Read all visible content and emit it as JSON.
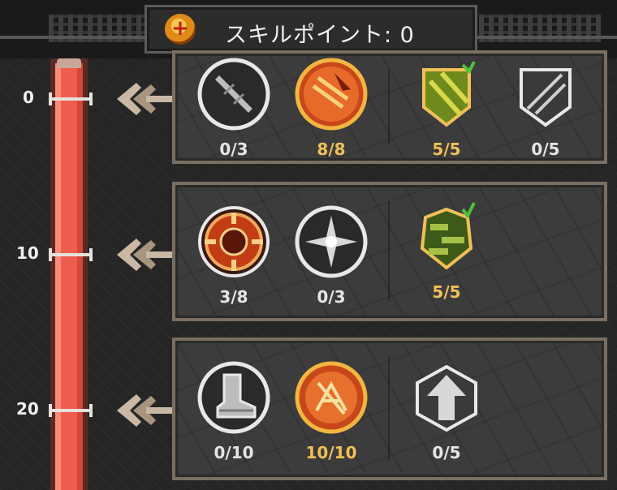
{
  "header": {
    "title": "スキルポイント: 0",
    "coin_icon": "skill-point-coin-icon"
  },
  "level_bar": {
    "fill_color": "#ef5c4e",
    "ticks": [
      "0",
      "10",
      "20"
    ]
  },
  "tiers": [
    {
      "skills": [
        {
          "icon": "sword-icon",
          "count": "0/3",
          "maxed": false
        },
        {
          "icon": "flame-strike-icon",
          "count": "8/8",
          "maxed": true
        },
        {
          "icon": "striped-shield-icon",
          "count": "5/5",
          "maxed": true
        },
        {
          "icon": "bone-shield-icon",
          "count": "0/5",
          "maxed": false
        }
      ]
    },
    {
      "skills": [
        {
          "icon": "fire-crosshair-icon",
          "count": "3/8",
          "maxed": false
        },
        {
          "icon": "star-burst-icon",
          "count": "0/3",
          "maxed": false
        },
        {
          "icon": "camo-shield-icon",
          "count": "5/5",
          "maxed": true
        }
      ]
    },
    {
      "skills": [
        {
          "icon": "boot-icon",
          "count": "0/10",
          "maxed": false
        },
        {
          "icon": "fire-rune-icon",
          "count": "10/10",
          "maxed": true
        },
        {
          "icon": "arrow-up-hex-icon",
          "count": "0/5",
          "maxed": false
        }
      ]
    }
  ],
  "colors": {
    "maxed_text": "#f0c058",
    "normal_text": "#e6e6e6",
    "panel_border": "#7a6f62"
  }
}
